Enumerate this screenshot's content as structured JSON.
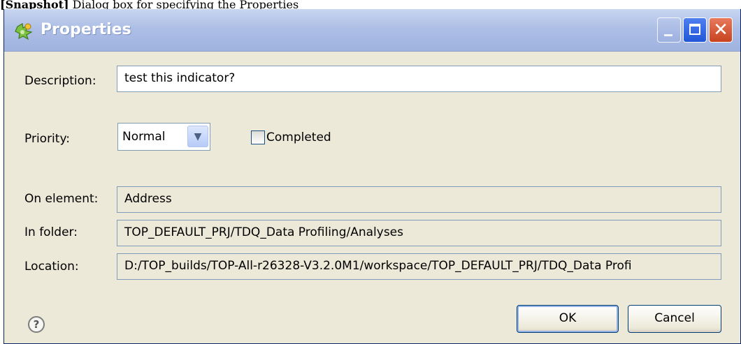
{
  "caption": {
    "bold": "[Snapshot]",
    "rest": " Dialog box for specifying the Properties"
  },
  "window": {
    "title": "Properties",
    "icon": "plugin-puzzle-icon"
  },
  "controls": {
    "minimize": "minimize-icon",
    "maximize": "maximize-icon",
    "close_glyph": "✕"
  },
  "form": {
    "description_label": "Description:",
    "description_value": "test this indicator?",
    "priority_label": "Priority:",
    "priority_value": "Normal",
    "priority_arrow": "▼",
    "completed_label": "Completed",
    "completed_checked": false,
    "on_element_label": "On element:",
    "on_element_value": "Address",
    "in_folder_label": "In folder:",
    "in_folder_value": "TOP_DEFAULT_PRJ/TDQ_Data Profiling/Analyses",
    "location_label": "Location:",
    "location_value": "D:/TOP_builds/TOP-All-r26328-V3.2.0M1/workspace/TOP_DEFAULT_PRJ/TDQ_Data Profi"
  },
  "buttons": {
    "help_glyph": "?",
    "ok": "OK",
    "cancel": "Cancel"
  },
  "colors": {
    "title_bar": "#aebfe6",
    "dialog_bg": "#ece9d8",
    "close_red": "#c8431f",
    "max_blue": "#2157d8"
  }
}
